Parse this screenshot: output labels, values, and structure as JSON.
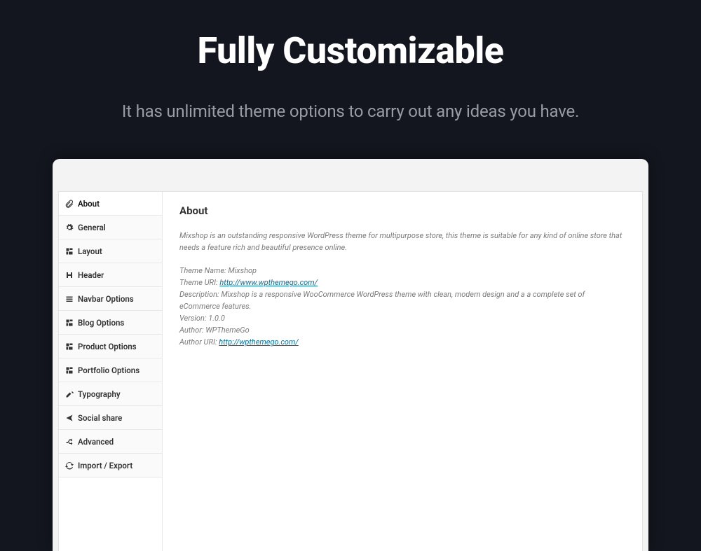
{
  "hero": {
    "title": "Fully Customizable",
    "subtitle": "It has unlimited theme options to carry out any ideas you have."
  },
  "sidebar": {
    "items": [
      {
        "label": "About",
        "icon": "paperclip-icon",
        "active": true
      },
      {
        "label": "General",
        "icon": "gear-icon",
        "active": false
      },
      {
        "label": "Layout",
        "icon": "layout-icon",
        "active": false
      },
      {
        "label": "Header",
        "icon": "header-icon",
        "active": false
      },
      {
        "label": "Navbar Options",
        "icon": "menu-icon",
        "active": false
      },
      {
        "label": "Blog Options",
        "icon": "layout-icon",
        "active": false
      },
      {
        "label": "Product Options",
        "icon": "layout-icon",
        "active": false
      },
      {
        "label": "Portfolio Options",
        "icon": "layout-icon",
        "active": false
      },
      {
        "label": "Typography",
        "icon": "edit-icon",
        "active": false
      },
      {
        "label": "Social share",
        "icon": "share-icon",
        "active": false
      },
      {
        "label": "Advanced",
        "icon": "shuffle-icon",
        "active": false
      },
      {
        "label": "Import / Export",
        "icon": "refresh-icon",
        "active": false
      }
    ]
  },
  "content": {
    "title": "About",
    "intro": "Mixshop is an outstanding responsive WordPress theme for multipurpose store, this theme is suitable for any kind of online store that needs a feature rich and beautiful presence online.",
    "theme_name_label": "Theme Name: ",
    "theme_name_value": "Mixshop",
    "theme_uri_label": "Theme URI: ",
    "theme_uri_value": "http://www.wpthemego.com/",
    "description_label": "Description: ",
    "description_value": "Mixshop is a responsive WooCommerce WordPress theme with clean, modern design and a a complete set of eCommerce features.",
    "version_label": "Version: ",
    "version_value": "1.0.0",
    "author_label": "Author: ",
    "author_value": "WPThemeGo",
    "author_uri_label": "Author URI: ",
    "author_uri_value": "http://wpthemego.com/"
  }
}
